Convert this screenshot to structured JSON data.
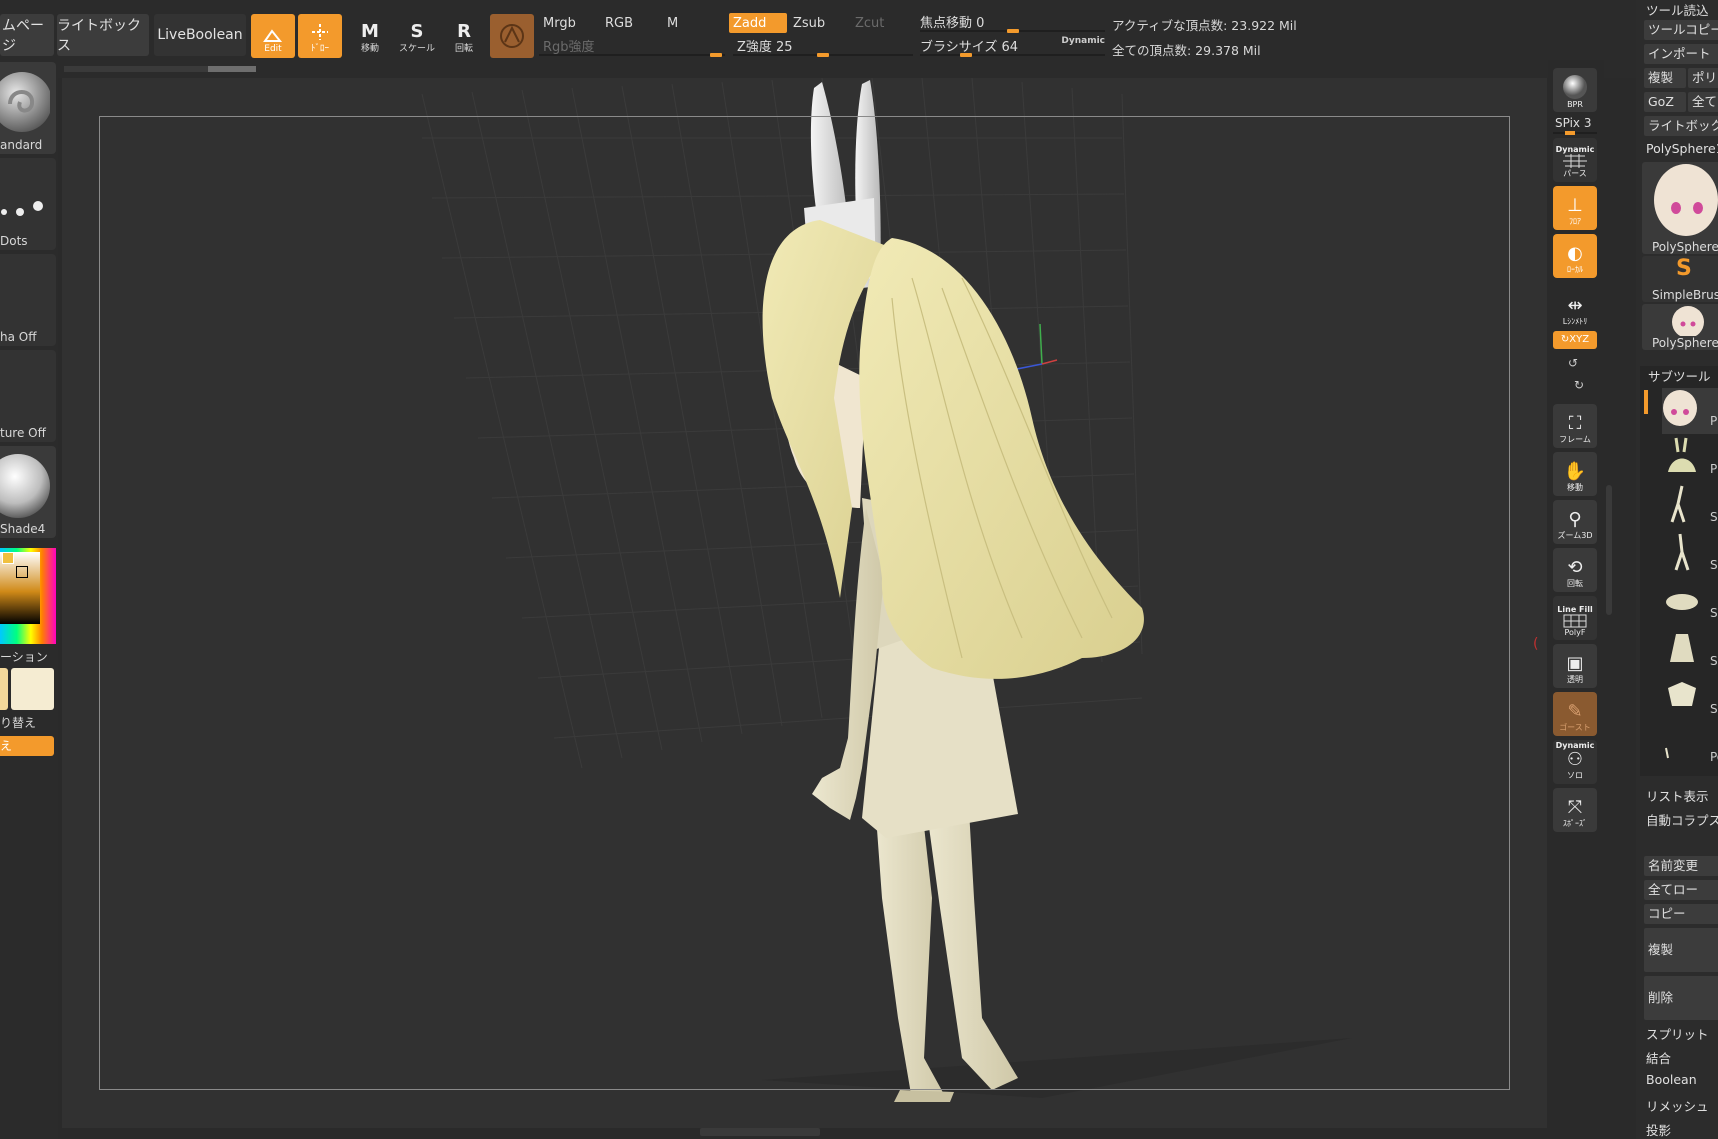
{
  "topbar": {
    "home_page_label": "ムページ",
    "lightbox_label": "ライトボックス",
    "liveboolean_label": "LiveBoolean",
    "edit_label": "Edit",
    "draw_label": "ﾄﾞﾛｰ",
    "move_label": "移動",
    "move_glyph": "M",
    "scale_label": "スケール",
    "scale_glyph": "S",
    "rotate_label": "回転",
    "rotate_glyph": "R",
    "mrgb_label": "Mrgb",
    "rgb_label": "RGB",
    "m_label": "M",
    "rgb_intensity_label": "Rgb強度",
    "zadd_label": "Zadd",
    "zsub_label": "Zsub",
    "zcut_label": "Zcut",
    "z_intensity_label": "Z強度 25",
    "focal_shift_label": "焦点移動 0",
    "brush_size_label": "ブラシサイズ 64",
    "dynamic_label": "Dynamic",
    "active_points_label": "アクティブな頂点数: 23.922 Mil",
    "total_points_label": "全ての頂点数: 29.378 Mil"
  },
  "sliders": {
    "rgb_intensity": 0.95,
    "z_intensity": 0.5,
    "focal_shift": 0.5,
    "brush_size": 0.25
  },
  "left_panel": {
    "brush_label": "andard",
    "stroke_label": "Dots",
    "alpha_label": "ha Off",
    "texture_label": "ture Off",
    "material_label": "Shade4",
    "gradient_label": "ーション",
    "switch_color_label": "り替え",
    "alternate_label": "え"
  },
  "right_shelf": {
    "bpr_label": "BPR",
    "spix_label": "SPix 3",
    "dynamic_label": "Dynamic",
    "perspective_label": "パース",
    "floor_label": "ﾌﾛｱ",
    "local_label": "ﾛｰｶﾙ",
    "symmetry_label": "Lｼﾝﾒﾄﾘ",
    "xyz_label": "XYZ",
    "frame_label": "フレーム",
    "move_label": "移動",
    "zoom3d_label": "ズーム3D",
    "rotate_label": "回転",
    "linefill_label": "Line Fill",
    "polyf_label": "PolyF",
    "transp_label": "透明",
    "ghost_label": "ゴースト",
    "solo_dynamic_label": "Dynamic",
    "solo_label": "ソロ",
    "xpose_label": "ｽﾎﾟｰｽﾞ"
  },
  "right_panel": {
    "load_tool_label": "ツール読込",
    "copy_tool_label": "ツールコピー",
    "import_label": "インポート",
    "clone_label": "複製",
    "poly_label": "ポリ",
    "goz_label": "GoZ",
    "all_label": "全て",
    "lightbox_label": "ライトボック",
    "tool_name_label": "PolySphere1",
    "thumb1_label": "PolySphere",
    "thumb2_label": "SimpleBrus",
    "thumb3_label": "PolySphere",
    "subtool_header": "サブツール",
    "subtool_labels": [
      "P",
      "PM",
      "Sk",
      "Sk",
      "Sk",
      "Sk",
      "Sk",
      "Po"
    ],
    "list_view_label": "リスト表示",
    "auto_collapse_label": "自動コラプス",
    "rename_label": "名前変更",
    "all_low_label": "全てロー",
    "copy_label": "コピー",
    "duplicate_label": "複製",
    "delete_label": "削除",
    "split_label": "スプリット",
    "merge_label": "結合",
    "boolean_label": "Boolean",
    "remesh_label": "リメッシュ",
    "project_label": "投影"
  },
  "colors": {
    "accent": "#f39a2c",
    "panel": "#2b2b2b",
    "viewport": "#313131",
    "model": "#e7e2bf"
  }
}
